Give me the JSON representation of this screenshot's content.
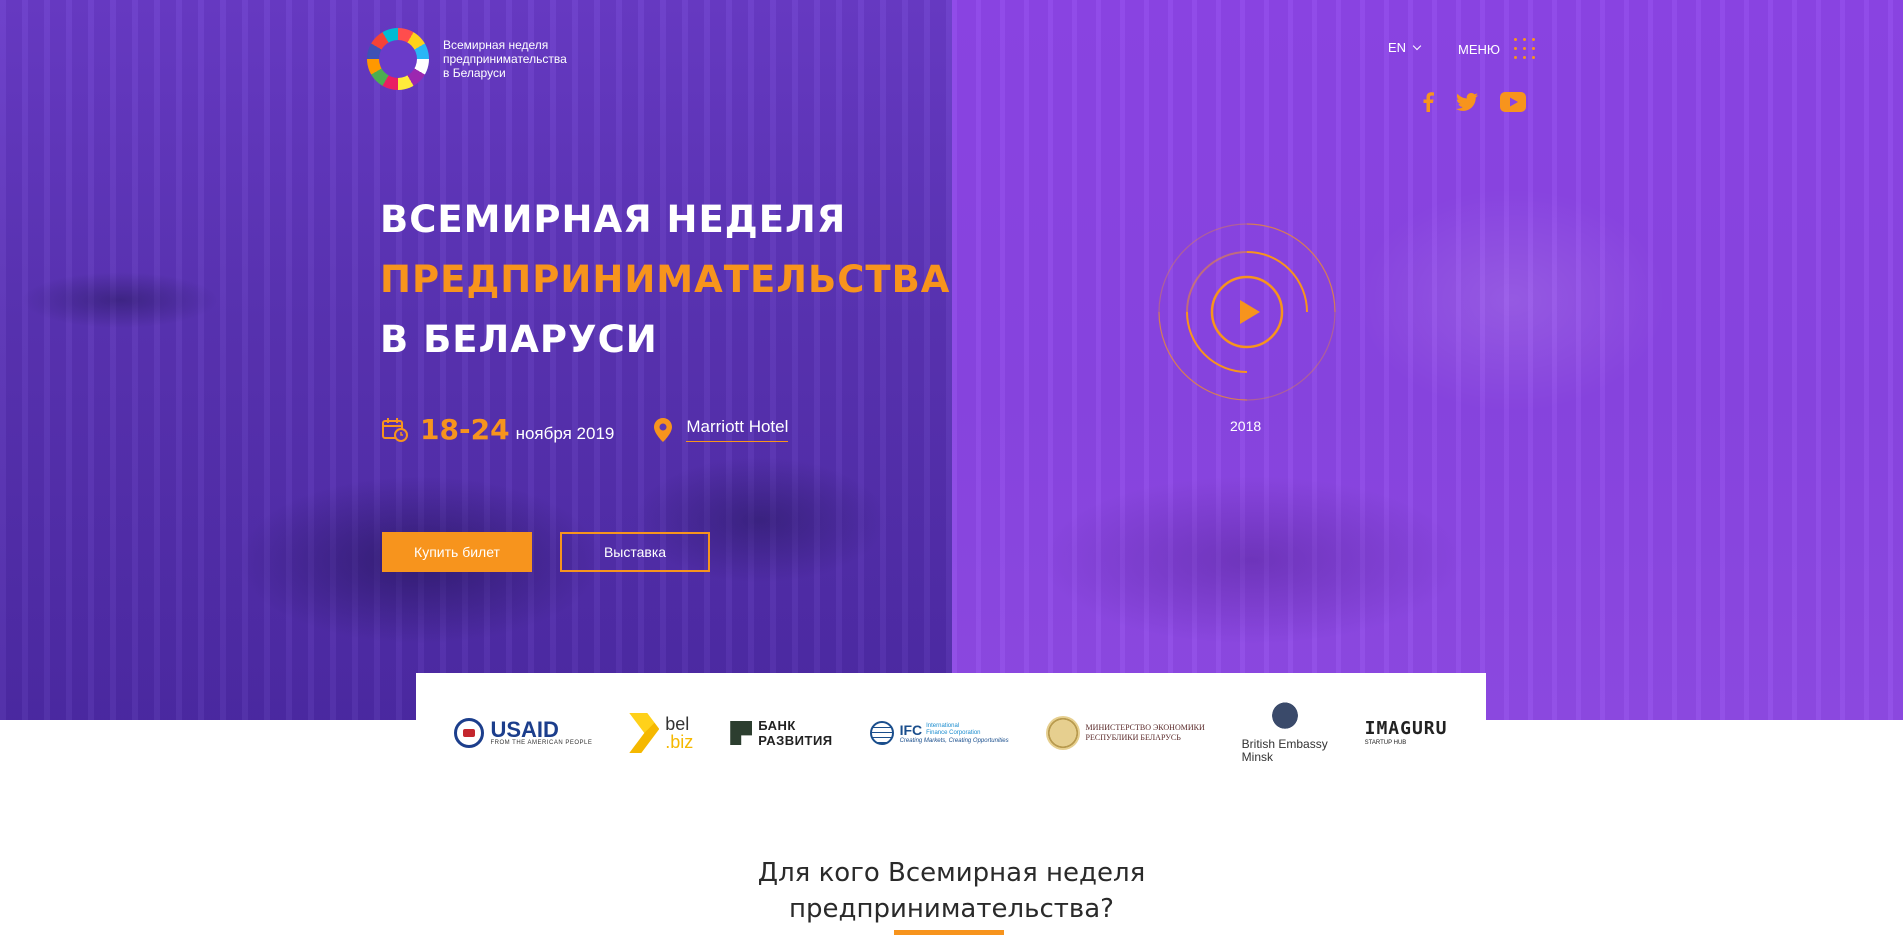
{
  "header": {
    "logo_line1": "Всемирная неделя",
    "logo_line2": "предпринимательства",
    "logo_line3": "в Беларуси",
    "lang": "EN",
    "menu_label": "МЕНЮ"
  },
  "social": [
    "facebook-icon",
    "twitter-icon",
    "youtube-icon"
  ],
  "hero": {
    "title_line1": "ВСЕМИРНАЯ НЕДЕЛЯ",
    "title_line2": "ПРЕДПРИНИМАТЕЛЬСТВА",
    "title_line3": "В БЕЛАРУСИ",
    "dates": "18-24",
    "month": "ноября 2019",
    "venue": "Marriott Hotel",
    "buy_label": "Купить билет",
    "expo_label": "Выставка",
    "video_year": "2018"
  },
  "partners": {
    "usaid": "USAID",
    "usaid_sub": "FROM THE AMERICAN PEOPLE",
    "belbiz_1": "bel",
    "belbiz_2": ".biz",
    "bank_1": "БАНК",
    "bank_2": "РАЗВИТИЯ",
    "ifc": "IFC",
    "ifc_sub1": "International",
    "ifc_sub2": "Finance Corporation",
    "ifc_tag": "Creating Markets, Creating Opportunities",
    "min_1": "МИНИСТЕРСТВО ЭКОНОМИКИ",
    "min_2": "РЕСПУБЛИКИ БЕЛАРУСЬ",
    "be_1": "British Embassy",
    "be_2": "Minsk",
    "imaguru": "IMAGURU",
    "imaguru_sub": "STARTUP HUB"
  },
  "section": {
    "who_line1": "Для кого Всемирная неделя",
    "who_line2": "предпринимательства?"
  },
  "colors": {
    "accent": "#f7941d",
    "left_bg": "#5a33b5",
    "right_bg": "#8a45e4"
  }
}
